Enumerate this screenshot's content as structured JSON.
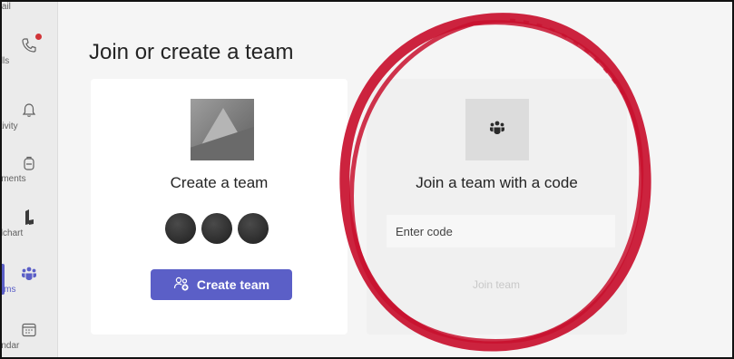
{
  "rail": {
    "items": [
      {
        "label": "email",
        "icon": "mail-icon"
      },
      {
        "label": "Calls",
        "icon": "phone-icon",
        "badge": true
      },
      {
        "label": "Activity",
        "icon": "bell-icon"
      },
      {
        "label": "ignments",
        "icon": "backpack-icon"
      },
      {
        "label": "icidchart",
        "icon": "lucidchart-icon"
      },
      {
        "label": "Teams",
        "icon": "teams-icon",
        "active": true
      },
      {
        "label": "alendar",
        "icon": "calendar-icon"
      }
    ]
  },
  "main": {
    "title": "Join or create a team",
    "create_card": {
      "title": "Create a team",
      "button_label": "Create team"
    },
    "join_card": {
      "title": "Join a team with a code",
      "input_placeholder": "Enter code",
      "button_label": "Join team"
    }
  },
  "colors": {
    "accent": "#5b5fc7",
    "annotation_red": "#c8102e",
    "badge": "#d13438"
  }
}
